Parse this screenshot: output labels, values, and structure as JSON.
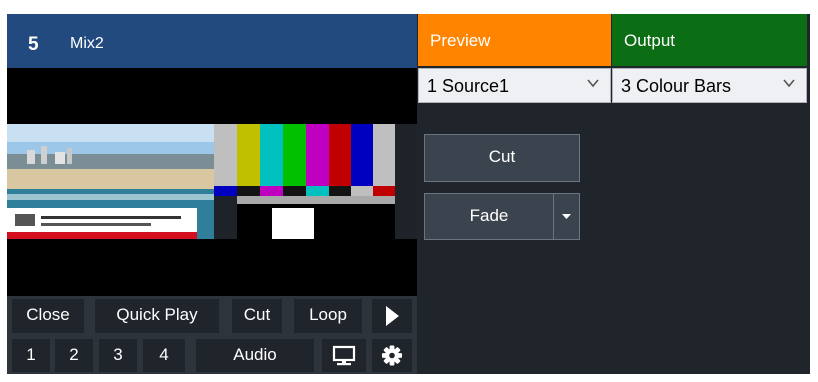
{
  "input": {
    "number": "5",
    "title": "Mix2"
  },
  "tabs": {
    "preview_label": "Preview",
    "output_label": "Output",
    "preview_color": "#ff8400",
    "output_color": "#0b6d14"
  },
  "selectors": {
    "preview_source": "1 Source1",
    "output_source": "3 Colour Bars"
  },
  "transitions": {
    "cut_label": "Cut",
    "fade_label": "Fade"
  },
  "controls_row1": {
    "close": "Close",
    "quick_play": "Quick Play",
    "cut": "Cut",
    "loop": "Loop"
  },
  "controls_row2": {
    "n1": "1",
    "n2": "2",
    "n3": "3",
    "n4": "4",
    "audio": "Audio"
  },
  "icons": [
    "play-icon",
    "monitor-icon",
    "gear-icon",
    "chevron-down-icon",
    "caret-down-icon"
  ],
  "colors": {
    "header_blue": "#234a7e",
    "panel_dark": "#1f252b",
    "button": "#3b444e"
  }
}
